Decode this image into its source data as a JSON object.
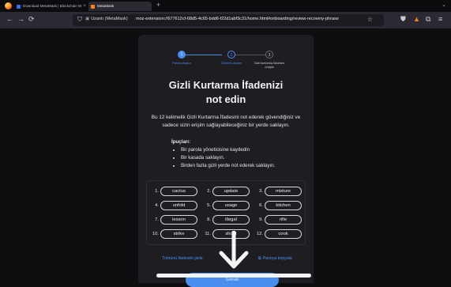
{
  "browser": {
    "tabs": [
      {
        "title": "Download MetaMask | Blockchain W",
        "active": false
      },
      {
        "title": "MetaMask",
        "active": true
      }
    ],
    "new_tab_icon": "plus-icon",
    "tabs_menu_icon": "chevron-down-icon",
    "nav_icons": [
      "back-arrow-icon",
      "forward-arrow-icon",
      "reload-icon"
    ],
    "identity": "Uzantı (MetaMask)",
    "url": "moz-extension://677612cf-68d5-4c65-bdd6-f22d1abf3c31/home.html#onboarding/review-recovery-phrase",
    "toolbar_icons": [
      "shield-icon",
      "metamask-fox-icon",
      "extensions-icon",
      "menu-icon"
    ]
  },
  "stepper": {
    "steps": [
      {
        "num": "1",
        "label": "Parola oluştur",
        "state": "done"
      },
      {
        "num": "2",
        "label": "Güvenli cüzdan",
        "state": "active"
      },
      {
        "num": "3",
        "label": "Gizli kurtarma İfadesini onayla",
        "state": "pending"
      }
    ],
    "accent": "#4a8ef0"
  },
  "title_line1": "Gizli Kurtarma İfadenizi",
  "title_line2": "not edin",
  "description": "Bu 12 kelimelik Gizli Kurtarma İfadesini not ederek güvendiğiniz ve sadece sizin erişim sağlayabileceğiniz bir yerde saklayın.",
  "tips": {
    "heading": "İpuçları:",
    "items": [
      "Bir parola yöneticisine kaydedin",
      "Bir kasada saklayın.",
      "Birden fazla gizli yerde not ederek saklayın."
    ]
  },
  "words": [
    {
      "num": "1.",
      "word": "cactus"
    },
    {
      "num": "2.",
      "word": "update"
    },
    {
      "num": "3.",
      "word": "mixture"
    },
    {
      "num": "4.",
      "word": "unfold"
    },
    {
      "num": "5.",
      "word": "usage"
    },
    {
      "num": "6.",
      "word": "kitchen"
    },
    {
      "num": "7.",
      "word": "lesson"
    },
    {
      "num": "8.",
      "word": "illegal"
    },
    {
      "num": "9.",
      "word": "rifle"
    },
    {
      "num": "10.",
      "word": "strike"
    },
    {
      "num": "11.",
      "word": "shoot"
    },
    {
      "num": "12.",
      "word": "cook"
    }
  ],
  "hide_link": "Tümünü ifadesini gizle",
  "copy_link": "Panoya kopyala",
  "next_button": "Sonraki",
  "overlay": {
    "gesture": "swipe-down-arrow-icon"
  }
}
